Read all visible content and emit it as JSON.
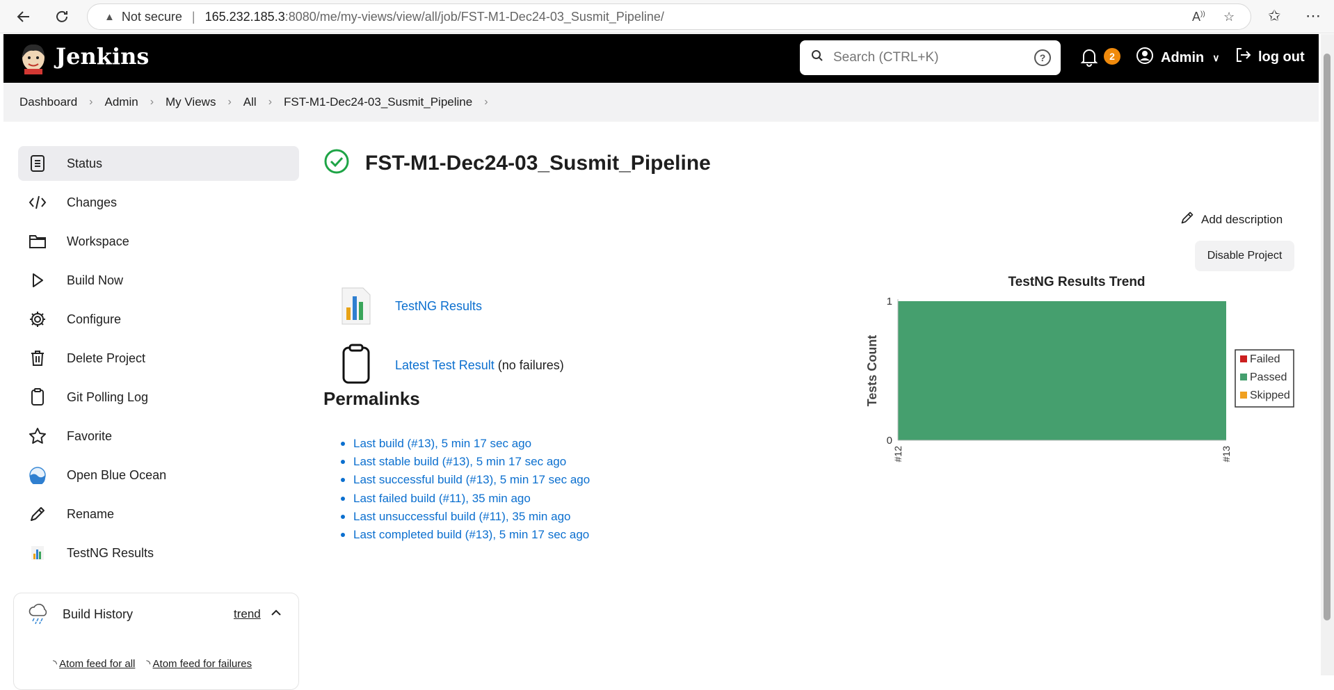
{
  "browser": {
    "security_label": "Not secure",
    "url_host": "165.232.185.3",
    "url_path": ":8080/me/my-views/view/all/job/FST-M1-Dec24-03_Susmit_Pipeline/"
  },
  "header": {
    "brand": "Jenkins",
    "search_placeholder": "Search (CTRL+K)",
    "notification_count": "2",
    "user_name": "Admin",
    "logout_label": "log out"
  },
  "breadcrumb": [
    "Dashboard",
    "Admin",
    "My Views",
    "All",
    "FST-M1-Dec24-03_Susmit_Pipeline"
  ],
  "sidebar": {
    "items": [
      {
        "label": "Status",
        "icon": "status-icon"
      },
      {
        "label": "Changes",
        "icon": "code-icon"
      },
      {
        "label": "Workspace",
        "icon": "folder-icon"
      },
      {
        "label": "Build Now",
        "icon": "play-icon"
      },
      {
        "label": "Configure",
        "icon": "gear-icon"
      },
      {
        "label": "Delete Project",
        "icon": "trash-icon"
      },
      {
        "label": "Git Polling Log",
        "icon": "clipboard-icon"
      },
      {
        "label": "Favorite",
        "icon": "star-icon"
      },
      {
        "label": "Open Blue Ocean",
        "icon": "blue-ocean-icon"
      },
      {
        "label": "Rename",
        "icon": "pencil-icon"
      },
      {
        "label": "TestNG Results",
        "icon": "testng-icon"
      }
    ]
  },
  "build_history": {
    "title": "Build History",
    "trend_label": "trend",
    "feed_all": "Atom feed for all",
    "feed_failures": "Atom feed for failures"
  },
  "main": {
    "title": "FST-M1-Dec24-03_Susmit_Pipeline",
    "add_description": "Add description",
    "disable_project": "Disable Project",
    "testng_link": "TestNG Results",
    "latest_test_link": "Latest Test Result",
    "latest_test_note": "(no failures)",
    "permalinks_heading": "Permalinks",
    "permalinks": [
      "Last build (#13), 5 min 17 sec ago",
      "Last stable build (#13), 5 min 17 sec ago",
      "Last successful build (#13), 5 min 17 sec ago",
      "Last failed build (#11), 35 min ago",
      "Last unsuccessful build (#11), 35 min ago",
      "Last completed build (#13), 5 min 17 sec ago"
    ]
  },
  "colors": {
    "accent_link": "#0b6fcf",
    "success": "#1ea446",
    "passed": "#459f6e",
    "failed": "#cc1f1f",
    "skipped": "#f0a020"
  },
  "chart_data": {
    "type": "area",
    "title": "TestNG Results Trend",
    "ylabel": "Tests Count",
    "xlabel": "",
    "categories": [
      "#12",
      "#13"
    ],
    "ylim": [
      0,
      1
    ],
    "yticks": [
      "0",
      "1"
    ],
    "series": [
      {
        "name": "Failed",
        "values": [
          0,
          0
        ],
        "color": "#cc1f1f"
      },
      {
        "name": "Passed",
        "values": [
          1,
          1
        ],
        "color": "#459f6e"
      },
      {
        "name": "Skipped",
        "values": [
          0,
          0
        ],
        "color": "#f0a020"
      }
    ],
    "legend": "right"
  }
}
